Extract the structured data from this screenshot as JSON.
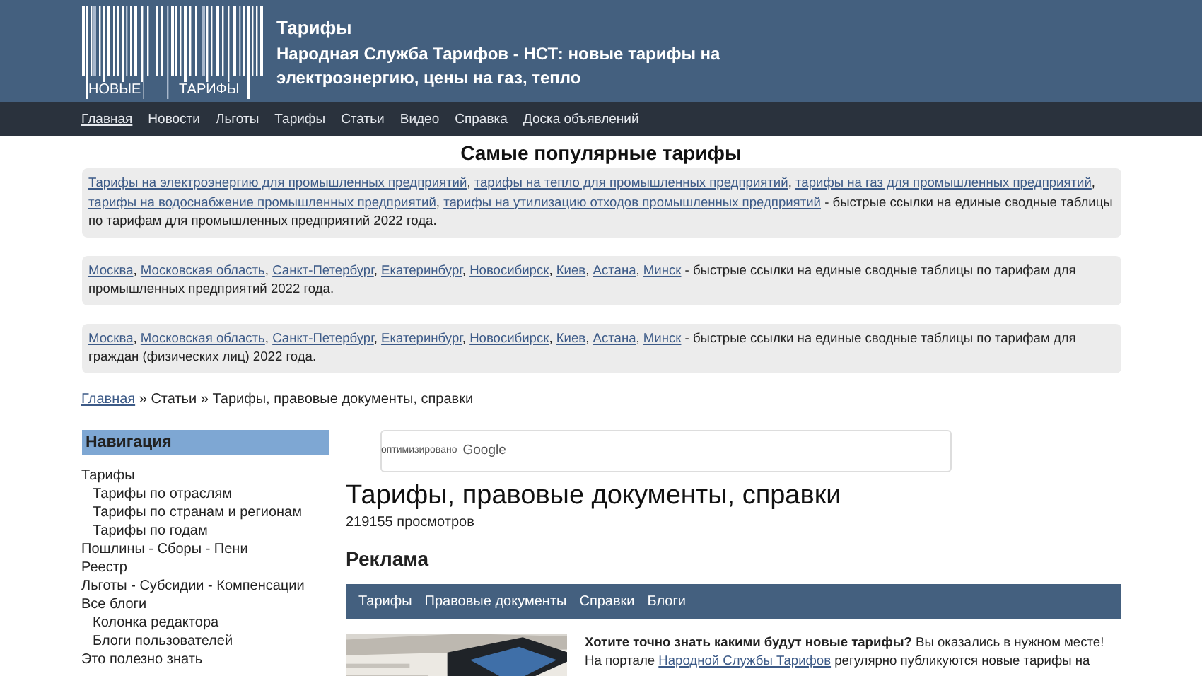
{
  "header": {
    "logo": [
      "НОВЫЕ",
      "ТАРИФЫ"
    ],
    "title": "Тарифы",
    "subtitle": "Народная Служба Тарифов - НСТ: новые тарифы на электроэнергию, цены на газ, тепло"
  },
  "nav": [
    {
      "label": "Главная",
      "selected": true
    },
    {
      "label": "Новости",
      "selected": false
    },
    {
      "label": "Льготы",
      "selected": false
    },
    {
      "label": "Тарифы",
      "selected": false
    },
    {
      "label": "Статьи",
      "selected": false
    },
    {
      "label": "Видео",
      "selected": false
    },
    {
      "label": "Справка",
      "selected": false
    },
    {
      "label": "Доска объявлений",
      "selected": false
    }
  ],
  "popular": {
    "title": "Самые популярные тарифы",
    "separator": ", ",
    "blocks": [
      {
        "links": [
          "Тарифы на электроэнергию для промышленных предприятий",
          "тарифы на тепло для промышленных предприятий",
          "тарифы на газ для промышленных предприятий",
          "тарифы на водоснабжение промышленных предприятий",
          "тарифы на утилизацию отходов промышленных предприятий"
        ],
        "text": " - быстрые ссылки на единые сводные таблицы по тарифам для промышленных предприятий 2022 года."
      },
      {
        "links": [
          "Москва",
          "Московская область",
          "Санкт-Петербург",
          "Екатеринбург",
          "Новосибирск",
          "Киев",
          "Астана",
          "Минск"
        ],
        "text": " - быстрые ссылки на единые сводные таблицы по тарифам для промышленных предприятий 2022 года."
      },
      {
        "links": [
          "Москва",
          "Московская область",
          "Санкт-Петербург",
          "Екатеринбург",
          "Новосибирск",
          "Киев",
          "Астана",
          "Минск"
        ],
        "text": " - быстрые ссылки на единые сводные таблицы по тарифам для граждан (физических лиц) 2022 года."
      }
    ]
  },
  "breadcrumbs": {
    "separator": " » ",
    "items": [
      {
        "label": "Главная",
        "link": true
      },
      {
        "label": "Статьи",
        "link": false
      },
      {
        "label": "Тарифы, правовые документы, справки",
        "link": false
      }
    ]
  },
  "sidebar": {
    "title": "Навигация",
    "items": [
      {
        "label": "Тарифы",
        "children": [
          {
            "label": "Тарифы по отраслям"
          },
          {
            "label": "Тарифы по странам и регионам"
          },
          {
            "label": "Тарифы по годам"
          }
        ]
      },
      {
        "label": "Пошлины - Сборы - Пени"
      },
      {
        "label": "Реестр"
      },
      {
        "label": "Льготы - Субсидии - Компенсации"
      },
      {
        "label": "Все блоги",
        "children": [
          {
            "label": "Колонка редактора"
          },
          {
            "label": "Блоги пользователей"
          }
        ]
      },
      {
        "label": "Это полезно знать"
      }
    ]
  },
  "search": {
    "hint_prefix": "оптимизировано",
    "hint_brand": "Google"
  },
  "article": {
    "title": "Тарифы, правовые документы, справки",
    "views": "219155 просмотров",
    "ad_heading": "Реклама",
    "tabs": [
      "Тарифы",
      "Правовые документы",
      "Справки",
      "Блоги"
    ],
    "intro": [
      {
        "kind": "bold",
        "text": "Хотите точно знать какими будут новые тарифы?"
      },
      {
        "kind": "text",
        "text": " Вы оказались в нужном месте! На портале "
      },
      {
        "kind": "link",
        "text": "Народной Службы Тарифов"
      },
      {
        "kind": "text",
        "text": " регулярно публикуются новые тарифы на"
      }
    ]
  }
}
